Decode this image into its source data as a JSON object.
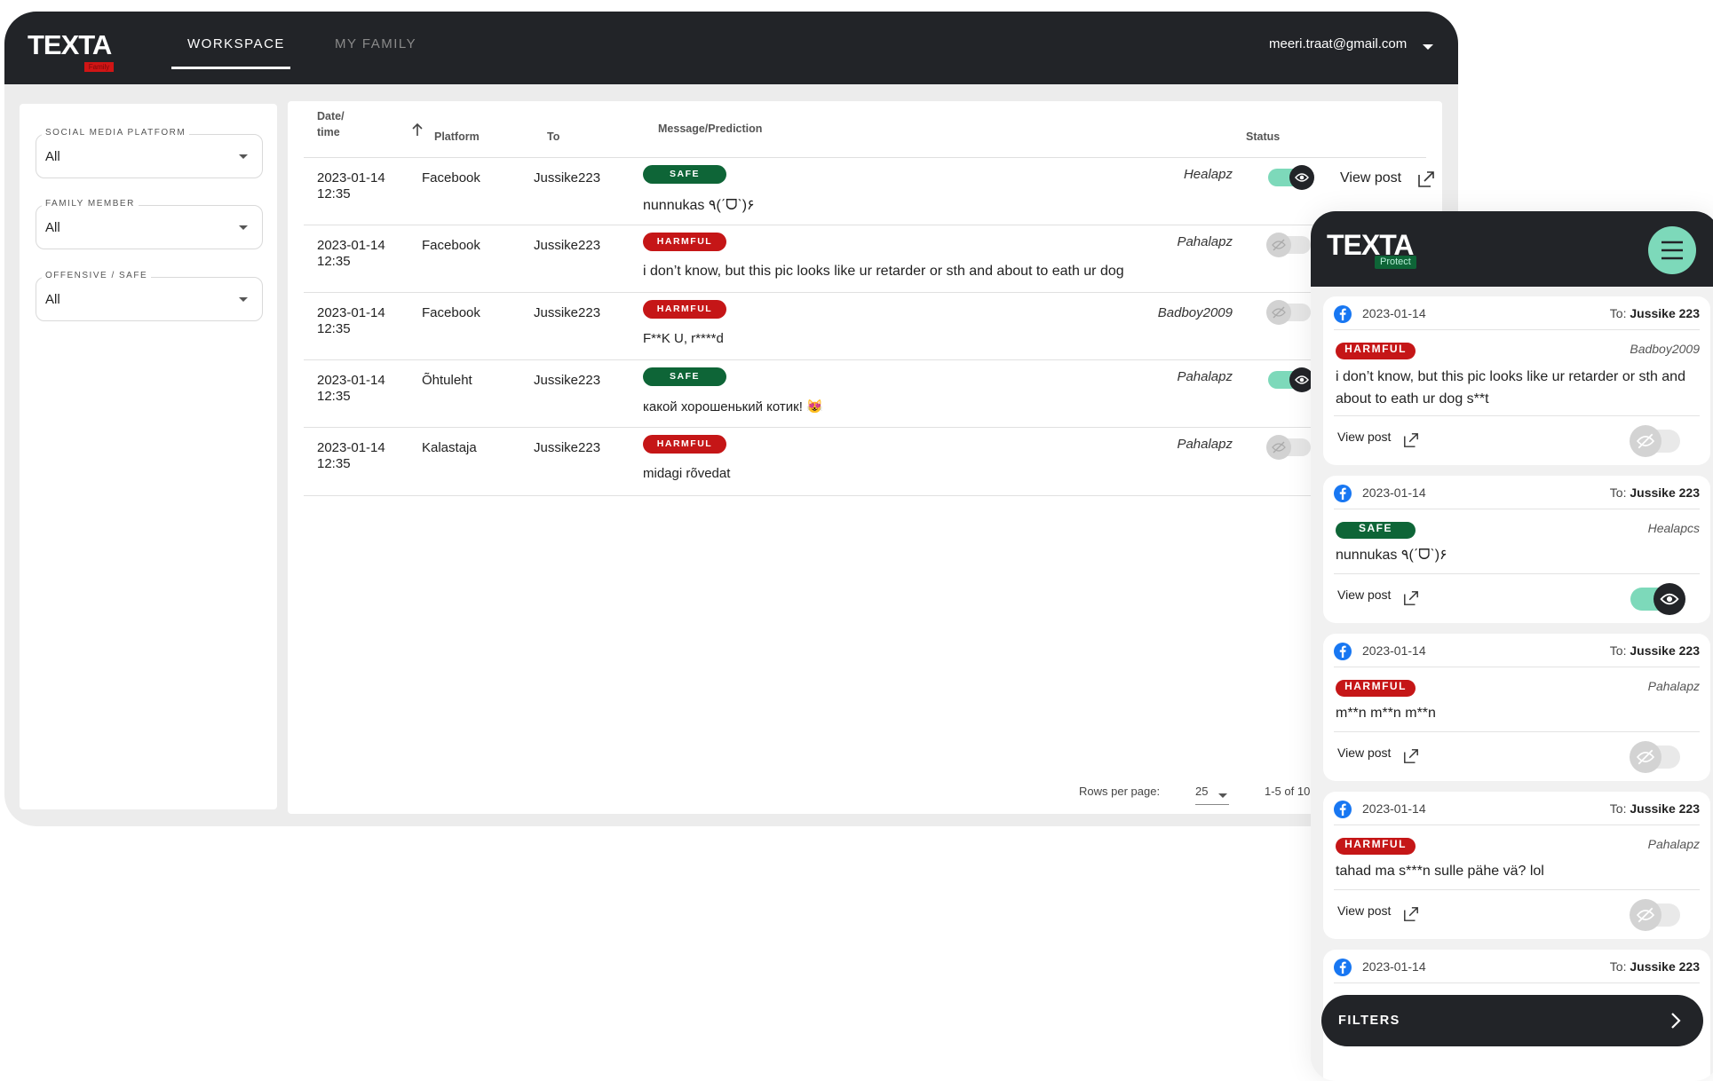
{
  "desktop": {
    "logo": {
      "text": "TEXTA",
      "badge": "Family"
    },
    "nav": {
      "workspace": "WORKSPACE",
      "my_family": "MY FAMILY"
    },
    "user_email": "meeri.traat@gmail.com",
    "filters": [
      {
        "label": "SOCIAL MEDIA PLATFORM",
        "value": "All"
      },
      {
        "label": "FAMILY MEMBER",
        "value": "All"
      },
      {
        "label": "OFFENSIVE / SAFE",
        "value": "All"
      }
    ],
    "table": {
      "headers": {
        "date_line1": "Date/",
        "date_line2": "time",
        "platform": "Platform",
        "to": "To",
        "message": "Message/Prediction",
        "status": "Status"
      },
      "rows": [
        {
          "date": "2023-01-14",
          "time": "12:35",
          "platform": "Facebook",
          "to": "Jussike223",
          "badge": "SAFE",
          "message": "nunnukas ٩(ˊᗜˋ)۶",
          "author": "Healapz",
          "status_on": true,
          "view_post": "View post"
        },
        {
          "date": "2023-01-14",
          "time": "12:35",
          "platform": "Facebook",
          "to": "Jussike223",
          "badge": "HARMFUL",
          "message": "i don’t know, but this pic looks like ur retarder or sth and about to eath ur dog",
          "author": "Pahalapz",
          "status_on": false
        },
        {
          "date": "2023-01-14",
          "time": "12:35",
          "platform": "Facebook",
          "to": "Jussike223",
          "badge": "HARMFUL",
          "message": "F**K U, r****d",
          "author": "Badboy2009",
          "status_on": false
        },
        {
          "date": "2023-01-14",
          "time": "12:35",
          "platform": "Õhtuleht",
          "to": "Jussike223",
          "badge": "SAFE",
          "message": "какой хорошенький котик! 😻",
          "author": "Pahalapz",
          "status_on": true
        },
        {
          "date": "2023-01-14",
          "time": "12:35",
          "platform": "Kalastaja",
          "to": "Jussike223",
          "badge": "HARMFUL",
          "message": "midagi rõvedat",
          "author": "Pahalapz",
          "status_on": false
        }
      ],
      "pagination": {
        "rows_per_page_label": "Rows per page:",
        "rows_per_page": "25",
        "range": "1-5 of 10"
      }
    }
  },
  "mobile": {
    "logo": {
      "text": "TEXTA",
      "badge": "Protect"
    },
    "cards": [
      {
        "date": "2023-01-14",
        "to_label": "To:",
        "to": "Jussike 223",
        "badge": "HARMFUL",
        "author": "Badboy2009",
        "message": "i don’t know, but this pic looks like ur retarder or sth and about to eath ur dog s**t",
        "view_post": "View post",
        "status_on": false
      },
      {
        "date": "2023-01-14",
        "to_label": "To:",
        "to": "Jussike 223",
        "badge": "SAFE",
        "author": "Healapcs",
        "message": "nunnukas ٩(ˊᗜˋ)۶",
        "view_post": "View post",
        "status_on": true
      },
      {
        "date": "2023-01-14",
        "to_label": "To:",
        "to": "Jussike 223",
        "badge": "HARMFUL",
        "author": "Pahalapz",
        "message": "m**n m**n m**n",
        "view_post": "View post",
        "status_on": false
      },
      {
        "date": "2023-01-14",
        "to_label": "To:",
        "to": "Jussike 223",
        "badge": "HARMFUL",
        "author": "Pahalapz",
        "message": "tahad ma s***n sulle pähe vä? lol",
        "view_post": "View post",
        "status_on": false
      },
      {
        "date": "2023-01-14",
        "to_label": "To:",
        "to": "Jussike 223"
      }
    ],
    "filters_button": "FILTERS"
  },
  "colors": {
    "dark": "#222428",
    "safe": "#0e6537",
    "harmful": "#c51617",
    "toggle_on": "#7dd9ba",
    "accent": "#7dd9ba"
  },
  "icons": {
    "sort": "arrow-up-icon",
    "external": "external-link-icon",
    "eye": "eye-icon",
    "eye_off": "eye-off-icon",
    "menu": "hamburger-menu-icon",
    "facebook": "facebook-icon",
    "chevron": "chevron-right-icon"
  }
}
